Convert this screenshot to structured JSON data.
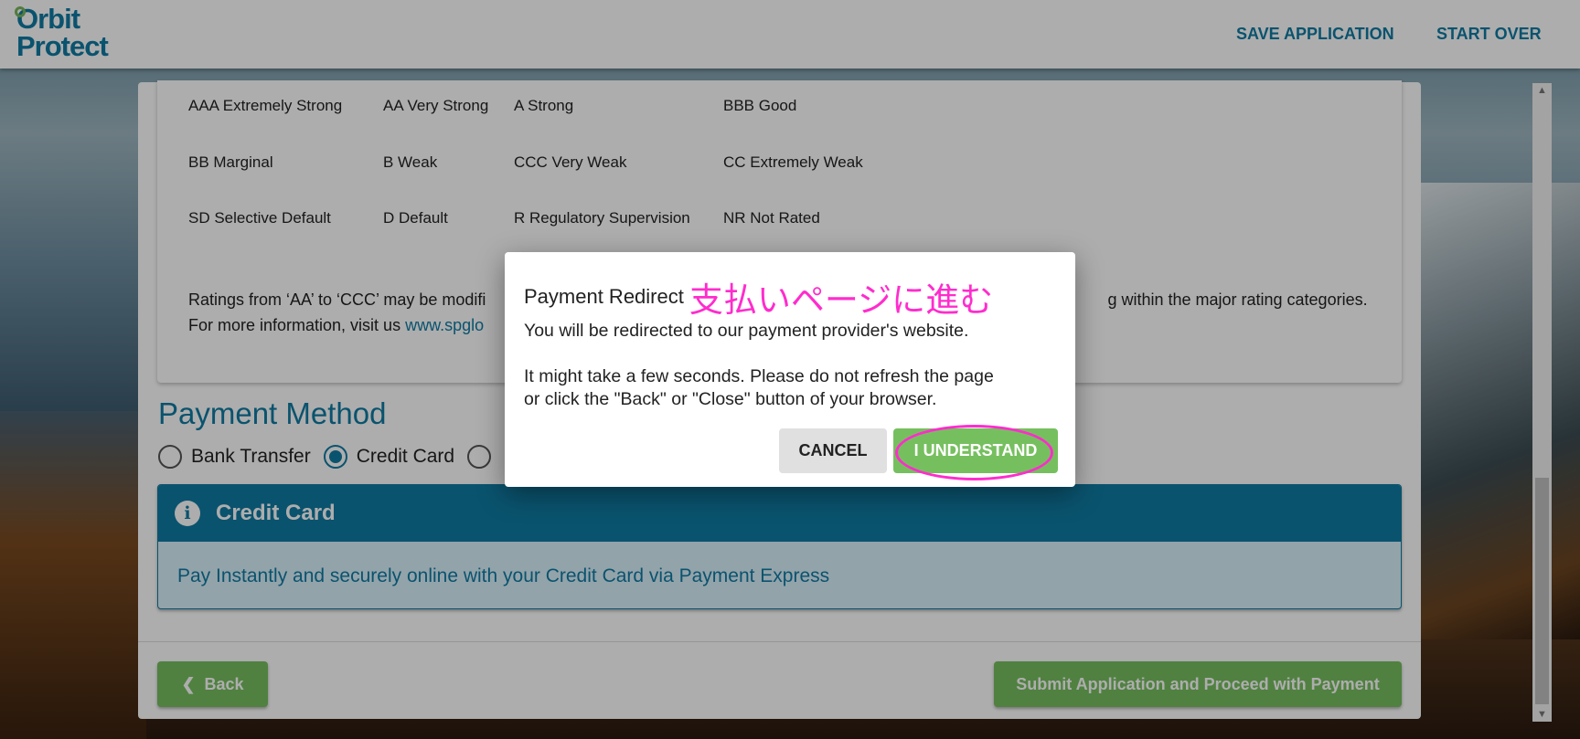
{
  "header": {
    "logo_line1": "Orbit",
    "logo_line2": "Protect",
    "save": "SAVE APPLICATION",
    "start_over": "START OVER"
  },
  "ratings": {
    "rows": [
      [
        "AAA Extremely Strong",
        "AA Very Strong",
        "A Strong",
        "BBB Good"
      ],
      [
        "BB Marginal",
        "B Weak",
        "CCC Very Weak",
        "CC Extremely Weak"
      ],
      [
        "SD Selective Default",
        "D Default",
        "R Regulatory Supervision",
        "NR Not Rated"
      ]
    ],
    "note1_start": "Ratings from ‘AA’ to ‘CCC’ may be modifi",
    "note1_end": "g within the major rating categories.",
    "note2": "For more information, visit us ",
    "link": "www.spglo"
  },
  "payment": {
    "title": "Payment Method",
    "options": [
      "Bank Transfer",
      "Credit Card",
      ""
    ],
    "selected": "Credit Card",
    "panel_title": "Credit Card",
    "panel_text": "Pay Instantly and securely online with your Credit Card via Payment Express"
  },
  "footer": {
    "back": "Back",
    "submit": "Submit Application and Proceed with Payment"
  },
  "modal": {
    "title": "Payment Redirect",
    "annotation": "支払いページに進む",
    "line1": "You will be redirected to our payment provider's website.",
    "line2": "It might take a few seconds. Please do not refresh the page or click the \"Back\" or \"Close\" button of your browser.",
    "cancel": "CANCEL",
    "confirm": "I UNDERSTAND"
  },
  "colors": {
    "brand": "#0f7ba3",
    "green": "#76bf5f",
    "annotation": "#ff2ccd"
  }
}
